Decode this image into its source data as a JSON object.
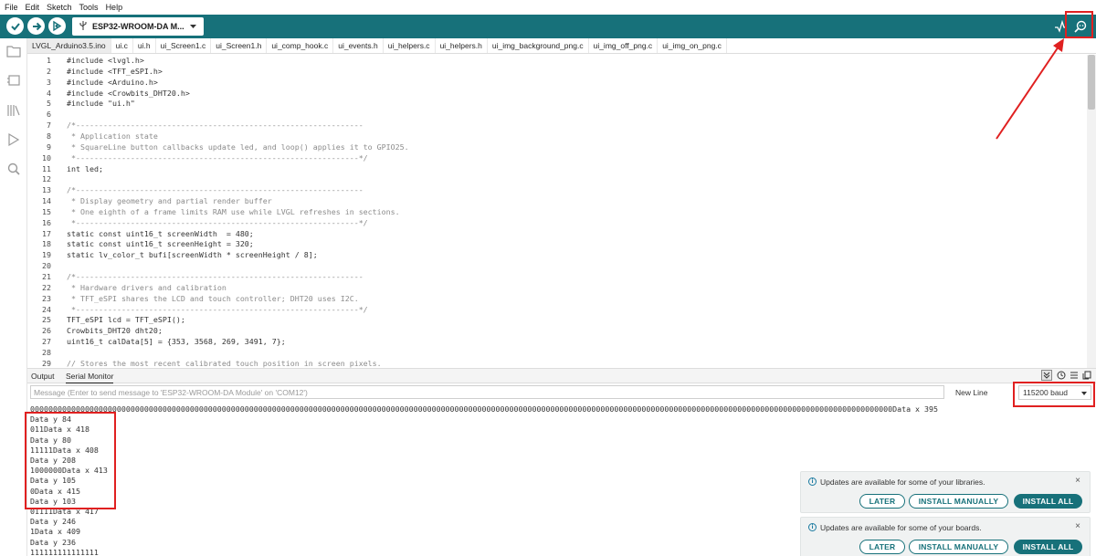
{
  "menu": [
    "File",
    "Edit",
    "Sketch",
    "Tools",
    "Help"
  ],
  "toolbar": {
    "board": "ESP32-WROOM-DA M...",
    "icons": [
      "verify-icon",
      "upload-icon",
      "debug-icon",
      "serial-plotter-icon",
      "serial-monitor-icon"
    ]
  },
  "sidebar": {
    "icons": [
      "folder-icon",
      "boards-manager-icon",
      "library-manager-icon",
      "debug-icon",
      "search-icon"
    ]
  },
  "tabs": [
    "LVGL_Arduino3.5.ino",
    "ui.c",
    "ui.h",
    "ui_Screen1.c",
    "ui_Screen1.h",
    "ui_comp_hook.c",
    "ui_events.h",
    "ui_helpers.c",
    "ui_helpers.h",
    "ui_img_background_png.c",
    "ui_img_off_png.c",
    "ui_img_on_png.c"
  ],
  "active_tab": "LVGL_Arduino3.5.ino",
  "code_lines": [
    {
      "n": "1",
      "t": "#include <lvgl.h>",
      "c": false
    },
    {
      "n": "2",
      "t": "#include <TFT_eSPI.h>",
      "c": false
    },
    {
      "n": "3",
      "t": "#include <Arduino.h>",
      "c": false
    },
    {
      "n": "4",
      "t": "#include <Crowbits_DHT20.h>",
      "c": false
    },
    {
      "n": "5",
      "t": "#include \"ui.h\"",
      "c": false
    },
    {
      "n": "6",
      "t": "",
      "c": false
    },
    {
      "n": "7",
      "t": "/*---------------------------------------------------------------",
      "c": true
    },
    {
      "n": "8",
      "t": " * Application state",
      "c": true
    },
    {
      "n": "9",
      "t": " * SquareLine button callbacks update led, and loop() applies it to GPIO25.",
      "c": true
    },
    {
      "n": "10",
      "t": " *--------------------------------------------------------------*/",
      "c": true
    },
    {
      "n": "11",
      "t": "int led;",
      "c": false
    },
    {
      "n": "12",
      "t": "",
      "c": false
    },
    {
      "n": "13",
      "t": "/*---------------------------------------------------------------",
      "c": true
    },
    {
      "n": "14",
      "t": " * Display geometry and partial render buffer",
      "c": true
    },
    {
      "n": "15",
      "t": " * One eighth of a frame limits RAM use while LVGL refreshes in sections.",
      "c": true
    },
    {
      "n": "16",
      "t": " *--------------------------------------------------------------*/",
      "c": true
    },
    {
      "n": "17",
      "t": "static const uint16_t screenWidth  = 480;",
      "c": false
    },
    {
      "n": "18",
      "t": "static const uint16_t screenHeight = 320;",
      "c": false
    },
    {
      "n": "19",
      "t": "static lv_color_t bufi[screenWidth * screenHeight / 8];",
      "c": false
    },
    {
      "n": "20",
      "t": "",
      "c": false
    },
    {
      "n": "21",
      "t": "/*---------------------------------------------------------------",
      "c": true
    },
    {
      "n": "22",
      "t": " * Hardware drivers and calibration",
      "c": true
    },
    {
      "n": "23",
      "t": " * TFT_eSPI shares the LCD and touch controller; DHT20 uses I2C.",
      "c": true
    },
    {
      "n": "24",
      "t": " *--------------------------------------------------------------*/",
      "c": true
    },
    {
      "n": "25",
      "t": "TFT_eSPI lcd = TFT_eSPI();",
      "c": false
    },
    {
      "n": "26",
      "t": "Crowbits_DHT20 dht20;",
      "c": false
    },
    {
      "n": "27",
      "t": "uint16_t calData[5] = {353, 3568, 269, 3491, 7};",
      "c": false
    },
    {
      "n": "28",
      "t": "",
      "c": false
    },
    {
      "n": "29",
      "t": "// Stores the most recent calibrated touch position in screen pixels.",
      "c": true
    }
  ],
  "panel": {
    "tab_output": "Output",
    "tab_serial": "Serial Monitor",
    "message_placeholder": "Message (Enter to send message to 'ESP32-WROOM-DA Module' on 'COM12')",
    "line_ending": "New Line",
    "baud": "115200 baud"
  },
  "serial_lines": [
    "000000000000000000000000000000000000000000000000000000000000000000000000000000000000000000000000000000000000000000000000000000000000000000000000000000000000000000000000000000000000000000000Data x 395",
    "Data y 84",
    "011Data x 418",
    "Data y 80",
    "11111Data x 408",
    "Data y 208",
    "1000000Data x 413",
    "Data y 105",
    "0Data x 415",
    "Data y 103",
    "01111Data x 417",
    "Data y 246",
    "1Data x 409",
    "Data y 236",
    "111111111111111"
  ],
  "notifications": [
    {
      "text": "Updates are available for some of your libraries.",
      "later": "LATER",
      "manual": "INSTALL MANUALLY",
      "install": "INSTALL ALL"
    },
    {
      "text": "Updates are available for some of your boards.",
      "later": "LATER",
      "manual": "INSTALL MANUALLY",
      "install": "INSTALL ALL"
    }
  ],
  "colors": {
    "toolbar": "#17717a",
    "annotation_red": "#e02020",
    "comment": "#8b8b8b"
  }
}
